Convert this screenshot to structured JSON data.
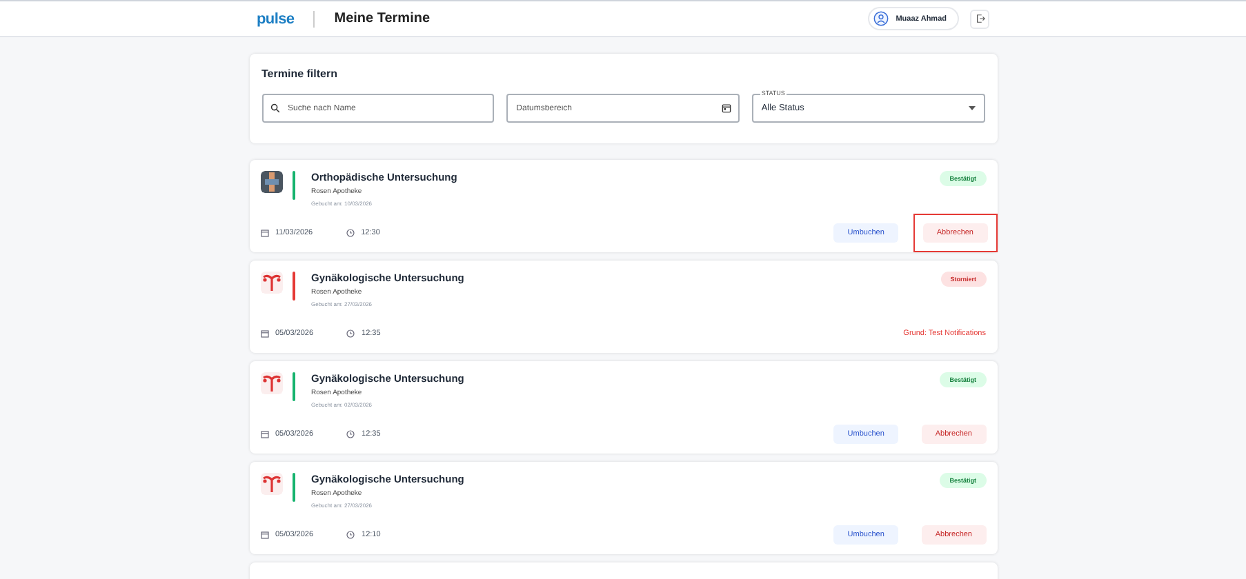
{
  "header": {
    "logo": "pulse",
    "title": "Meine Termine",
    "user": "Muaaz Ahmad"
  },
  "filter": {
    "title": "Termine filtern",
    "search": {
      "placeholder": "Suche nach Name"
    },
    "date": {
      "placeholder": "Datumsbereich"
    },
    "status": {
      "label": "STATUS",
      "value": "Alle Status"
    }
  },
  "appointments": [
    {
      "kind": "ortho",
      "title": "Orthopädische Untersuchung",
      "place": "Rosen Apotheke",
      "booked": "Gebucht am: 10/03/2026",
      "date": "11/03/2026",
      "time": "12:30",
      "status": {
        "kind": "confirmed",
        "label": "Bestätigt"
      },
      "actions": [
        {
          "kind": "reschedule",
          "label": "Umbuchen",
          "highlighted": false
        },
        {
          "kind": "cancel",
          "label": "Abbrechen",
          "highlighted": true
        }
      ]
    },
    {
      "kind": "gyn",
      "title": "Gynäkologische Untersuchung",
      "place": "Rosen Apotheke",
      "booked": "Gebucht am: 27/03/2026",
      "date": "05/03/2026",
      "time": "12:35",
      "status": {
        "kind": "cancelled",
        "label": "Storniert"
      },
      "reason": "Grund: Test Notifications"
    },
    {
      "kind": "gyn",
      "title": "Gynäkologische Untersuchung",
      "place": "Rosen Apotheke",
      "booked": "Gebucht am: 02/03/2026",
      "date": "05/03/2026",
      "time": "12:35",
      "status": {
        "kind": "confirmed",
        "label": "Bestätigt"
      },
      "actions": [
        {
          "kind": "reschedule",
          "label": "Umbuchen",
          "highlighted": false
        },
        {
          "kind": "cancel",
          "label": "Abbrechen",
          "highlighted": false
        }
      ]
    },
    {
      "kind": "gyn",
      "title": "Gynäkologische Untersuchung",
      "place": "Rosen Apotheke",
      "booked": "Gebucht am: 27/03/2026",
      "date": "05/03/2026",
      "time": "12:10",
      "status": {
        "kind": "confirmed",
        "label": "Bestätigt"
      },
      "actions": [
        {
          "kind": "reschedule",
          "label": "Umbuchen",
          "highlighted": false
        },
        {
          "kind": "cancel",
          "label": "Abbrechen",
          "highlighted": false
        }
      ]
    }
  ]
}
